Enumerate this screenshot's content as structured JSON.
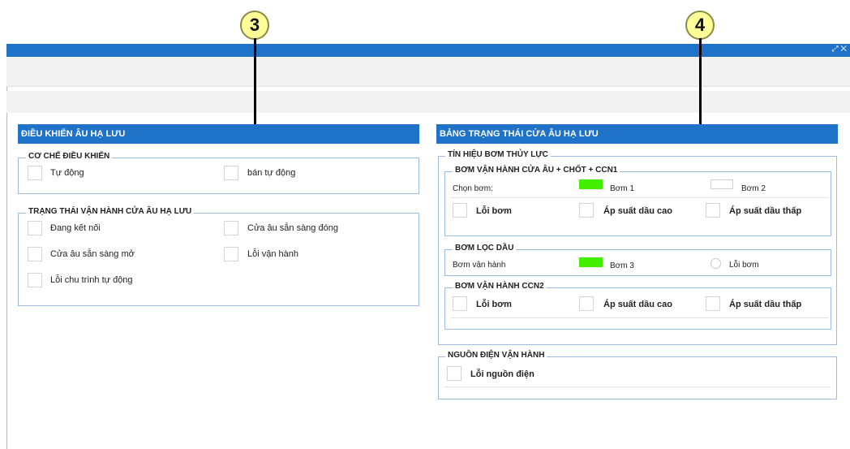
{
  "callouts": {
    "left": "3",
    "right": "4"
  },
  "window": {
    "controls": "⤢ ✕"
  },
  "left_panel": {
    "title": "ĐIỀU KHIỂN ÂU HẠ LƯU",
    "control_mode": {
      "legend": "CƠ CHẾ ĐIỀU KHIỂN",
      "auto": "Tự động",
      "semi_auto": "bán tự động"
    },
    "operation_status": {
      "legend": "TRẠNG THÁI VẬN HÀNH CỬA ÂU HẠ LƯU",
      "connecting": "Đang kết nối",
      "ready_close": "Cửa âu sẵn sàng đóng",
      "ready_open": "Cửa âu sẵn sàng mở",
      "operation_error": "Lỗi vận hành",
      "auto_cycle_error": "Lỗi chu trình tự động"
    }
  },
  "right_panel": {
    "title": "BẢNG TRẠNG THÁI CỬA ÂU HẠ LƯU",
    "hydraulic": {
      "legend": "TÍN HIỆU BƠM THỦY LỰC",
      "gate_pump": {
        "legend": "BƠM VẬN HÀNH CỬA ÂU + CHỐT + CCN1",
        "select_label": "Chọn bơm:",
        "pump1": "Bơm 1",
        "pump2": "Bơm 2",
        "pump1_color": "#44ee00",
        "pump_error": "Lỗi bơm",
        "high_pressure": "Áp suất dầu cao",
        "low_pressure": "Áp suất dầu thấp"
      },
      "oil_filter": {
        "legend": "BƠM LỌC DẦU",
        "running_label": "Bơm vận hành",
        "pump3": "Bơm 3",
        "pump3_color": "#44ee00",
        "pump_error": "Lỗi bơm"
      },
      "ccn2": {
        "legend": "BƠM VẬN HÀNH CCN2",
        "pump_error": "Lỗi bơm",
        "high_pressure": "Áp suất dầu cao",
        "low_pressure": "Áp suất dầu thấp"
      }
    },
    "power": {
      "legend": "NGUỒN ĐIỆN VẬN HÀNH",
      "power_error": "Lỗi nguồn điện"
    }
  }
}
